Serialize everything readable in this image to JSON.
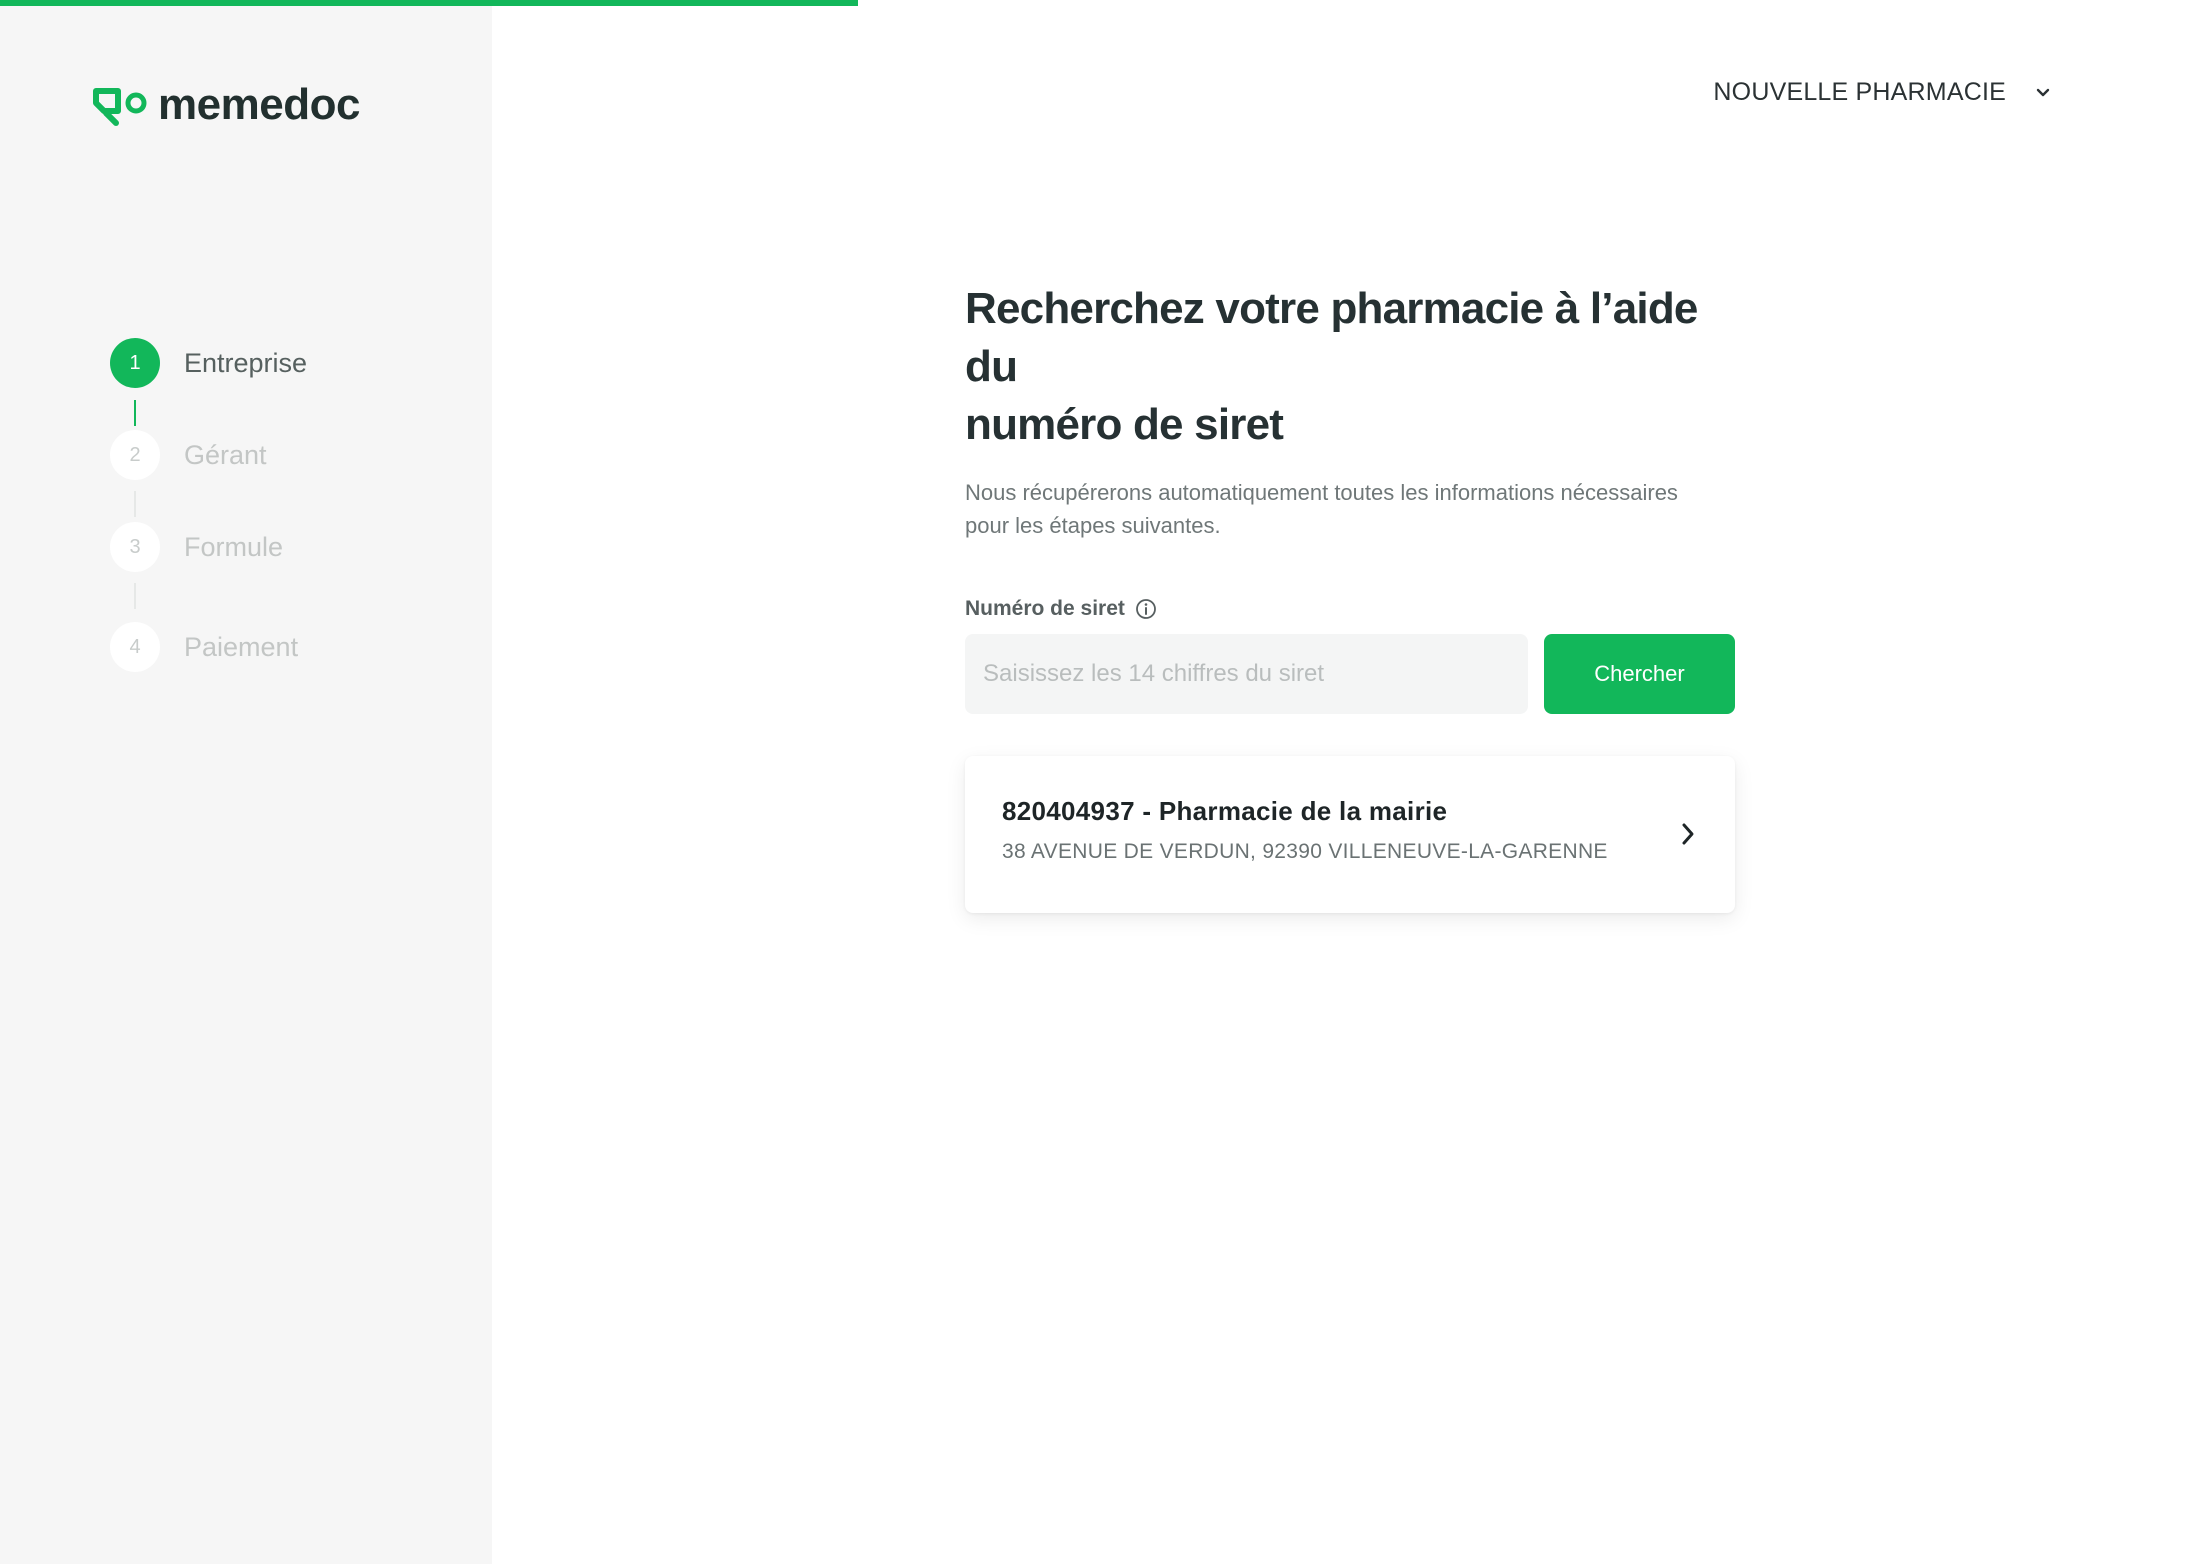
{
  "progress": {
    "fraction": 0.39,
    "color": "#12b75a"
  },
  "brand": {
    "name": "memedoc",
    "color": "#12b75a"
  },
  "steps": [
    {
      "number": "1",
      "label": "Entreprise",
      "state": "active"
    },
    {
      "number": "2",
      "label": "Gérant",
      "state": "pending"
    },
    {
      "number": "3",
      "label": "Formule",
      "state": "pending"
    },
    {
      "number": "4",
      "label": "Paiement",
      "state": "pending"
    }
  ],
  "header": {
    "pharmacy_select": "NOUVELLE PHARMACIE",
    "icon": "chevron-down-icon"
  },
  "main": {
    "title_line1": "Recherchez votre pharmacie à l’aide du",
    "title_line2": "numéro de siret",
    "subtitle_line1": "Nous récupérerons automatiquement toutes les informations nécessaires",
    "subtitle_line2": "pour les étapes suivantes.",
    "siret_label": "Numéro de siret",
    "siret_placeholder": "Saisissez les 14 chiffres du siret",
    "siret_value": "",
    "search_button": "Chercher",
    "result": {
      "title": "820404937 - Pharmacie de la mairie",
      "address": "38 AVENUE DE VERDUN, 92390 VILLENEUVE-LA-GARENNE"
    }
  }
}
